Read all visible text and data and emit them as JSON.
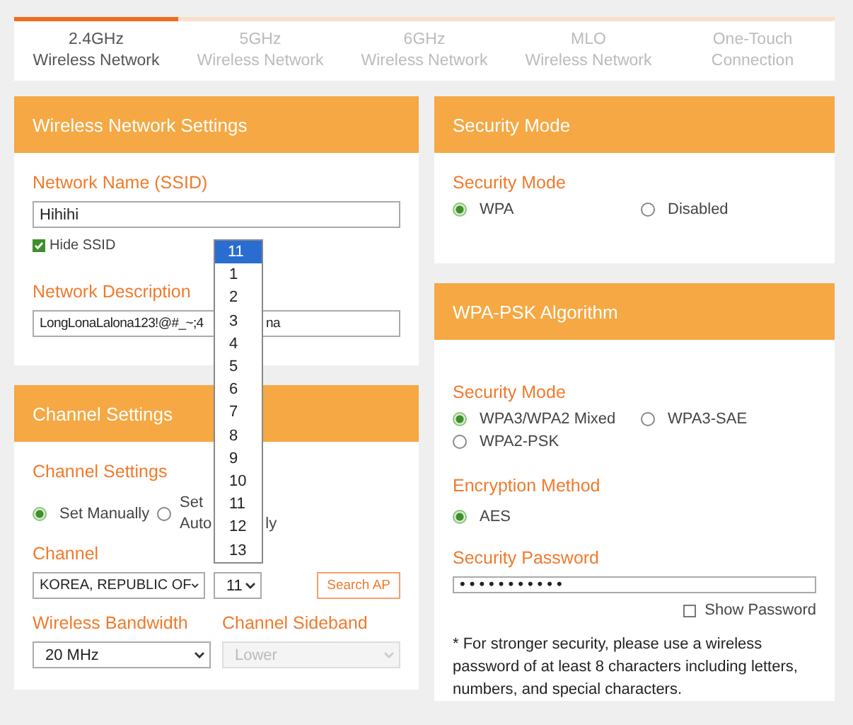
{
  "tabs": [
    {
      "line1": "2.4GHz",
      "line2": "Wireless Network",
      "selected": true
    },
    {
      "line1": "5GHz",
      "line2": "Wireless Network",
      "selected": false
    },
    {
      "line1": "6GHz",
      "line2": "Wireless Network",
      "selected": false
    },
    {
      "line1": "MLO",
      "line2": "Wireless Network",
      "selected": false
    },
    {
      "line1": "One-Touch",
      "line2": "Connection",
      "selected": false
    }
  ],
  "wireless_settings": {
    "title": "Wireless Network Settings",
    "ssid_label": "Network Name (SSID)",
    "ssid_value": "Hihihi",
    "hide_ssid": {
      "label": "Hide SSID",
      "checked": true
    },
    "description_label": "Network Description",
    "description_head": "LongLonaLalona123!@#_~;4",
    "description_tail": "na"
  },
  "channel_settings": {
    "title": "Channel Settings",
    "section_label": "Channel Settings",
    "radios": [
      {
        "label": "Set Manually",
        "selected": true
      },
      {
        "label": "Set",
        "line2_head": "Auto",
        "line2_tail": "ly",
        "selected": false
      }
    ],
    "channel_label": "Channel",
    "country": "KOREA, REPUBLIC OF",
    "channel": "11",
    "search_button": "Search AP",
    "bandwidth_label": "Wireless Bandwidth",
    "bandwidth": "20 MHz",
    "sideband_label": "Channel Sideband",
    "sideband": "Lower",
    "sideband_disabled": true
  },
  "channel_dropdown": [
    {
      "label": "11",
      "selected": true
    },
    {
      "label": "1",
      "selected": false
    },
    {
      "label": "2",
      "selected": false
    },
    {
      "label": "3",
      "selected": false
    },
    {
      "label": "4",
      "selected": false
    },
    {
      "label": "5",
      "selected": false
    },
    {
      "label": "6",
      "selected": false
    },
    {
      "label": "7",
      "selected": false
    },
    {
      "label": "8",
      "selected": false
    },
    {
      "label": "9",
      "selected": false
    },
    {
      "label": "10",
      "selected": false
    },
    {
      "label": "11",
      "selected": false
    },
    {
      "label": "12",
      "selected": false
    },
    {
      "label": "13",
      "selected": false
    }
  ],
  "security": {
    "title": "Security Mode",
    "label": "Security Mode",
    "radios": [
      {
        "label": "WPA",
        "selected": true
      },
      {
        "label": "Disabled",
        "selected": false
      }
    ]
  },
  "wpa_psk": {
    "title": "WPA-PSK Algorithm",
    "mode_label": "Security Mode",
    "modes": [
      {
        "label": "WPA3/WPA2 Mixed",
        "selected": true
      },
      {
        "label": "WPA3-SAE",
        "selected": false
      },
      {
        "label": "WPA2-PSK",
        "selected": false
      }
    ],
    "encryption_label": "Encryption Method",
    "encryptions": [
      {
        "label": "AES",
        "selected": true
      }
    ],
    "password_label": "Security Password",
    "password": "•••••••••••",
    "show_password": {
      "label": "Show Password",
      "checked": false
    },
    "note": "* For stronger security, please use a wireless password of at least 8 characters including letters, numbers, and special characters."
  }
}
